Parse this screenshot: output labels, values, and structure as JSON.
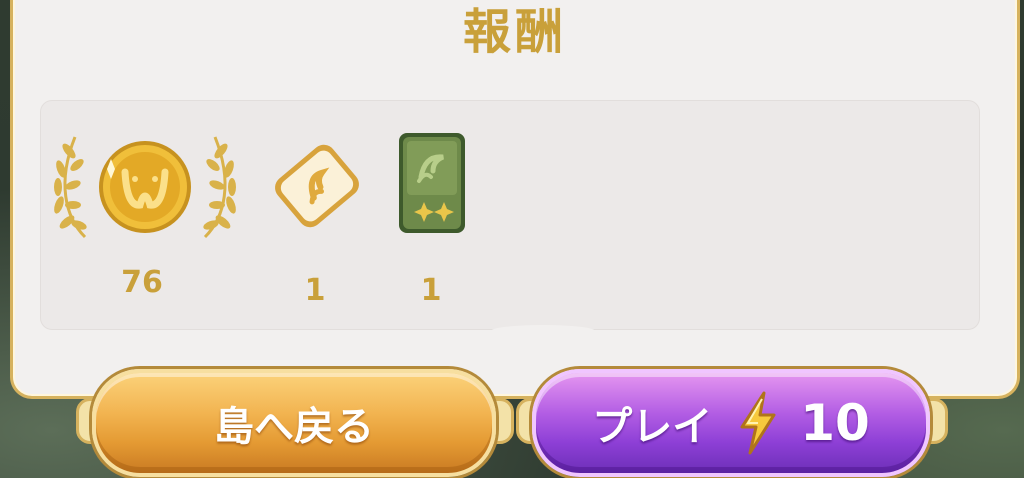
{
  "title": "報酬",
  "rewards": [
    {
      "icon": "gold-coin-icon",
      "count": "76"
    },
    {
      "icon": "ticket-icon",
      "count": "1"
    },
    {
      "icon": "green-card-pack-icon",
      "count": "1"
    }
  ],
  "buttons": {
    "back_label": "島へ戻る",
    "play_label": "プレイ",
    "play_cost": "10"
  },
  "colors": {
    "gold_text": "#c9a03a",
    "panel_bg": "#f2f0ef",
    "back_button": "#f2b451",
    "play_button": "#8d3fd6"
  }
}
